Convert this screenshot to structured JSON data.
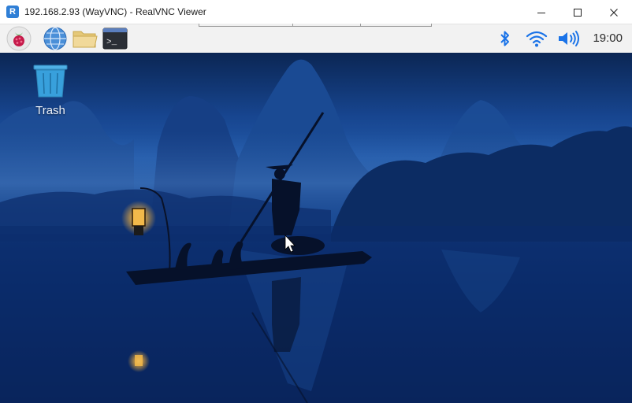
{
  "window": {
    "title": "192.168.2.93 (WayVNC) - RealVNC Viewer",
    "app_icon": "realvnc-icon",
    "app_icon_glyph": "R"
  },
  "taskbar": {
    "launchers": [
      {
        "name": "raspberry-menu-icon"
      },
      {
        "name": "web-browser-icon"
      },
      {
        "name": "file-manager-icon"
      },
      {
        "name": "terminal-icon"
      }
    ],
    "terminal_glyph": ">_",
    "tray": [
      "bluetooth-icon",
      "wifi-icon",
      "volume-icon"
    ],
    "clock": "19:00"
  },
  "desktop": {
    "icons": [
      {
        "name": "trash-icon",
        "label": "Trash"
      }
    ],
    "wallpaper": "misty karst mountains, fisherman on bamboo raft with cormorants and lantern"
  },
  "colors": {
    "accent": "#1a73e8",
    "taskbar_bg": "#f2f2f2",
    "sky_top": "#0b2654",
    "water": "#0a2a66"
  }
}
